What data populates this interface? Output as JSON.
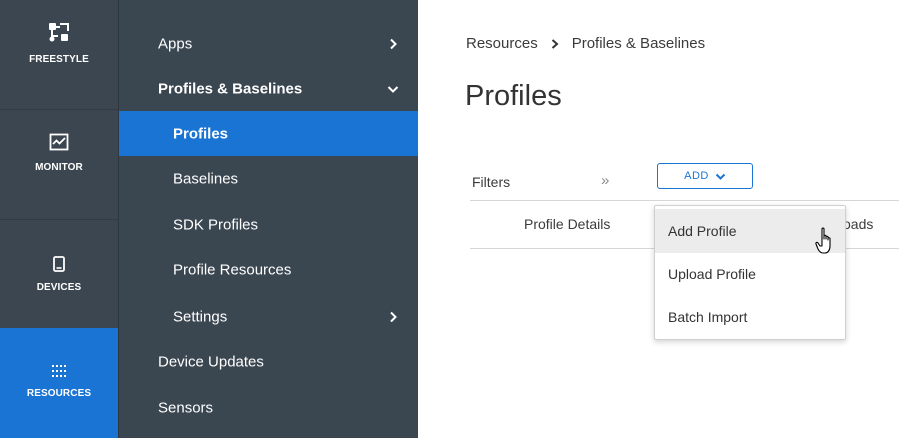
{
  "rail": {
    "items": [
      {
        "label": "FREESTYLE",
        "icon": "freestyle-icon"
      },
      {
        "label": "MONITOR",
        "icon": "monitor-icon"
      },
      {
        "label": "DEVICES",
        "icon": "device-icon"
      },
      {
        "label": "RESOURCES",
        "icon": "resources-icon"
      }
    ]
  },
  "subnav": {
    "items": [
      {
        "label": "Apps",
        "chevron": "right"
      },
      {
        "label": "Profiles & Baselines",
        "chevron": "down"
      },
      {
        "label": "Profiles"
      },
      {
        "label": "Baselines"
      },
      {
        "label": "SDK Profiles"
      },
      {
        "label": "Profile Resources"
      },
      {
        "label": "Settings",
        "chevron": "right"
      },
      {
        "label": "Device Updates"
      },
      {
        "label": "Sensors"
      }
    ]
  },
  "breadcrumb": {
    "root": "Resources",
    "current": "Profiles & Baselines"
  },
  "page": {
    "title": "Profiles"
  },
  "toolbar": {
    "filters_label": "Filters",
    "expand_glyph": "»",
    "add_label": "ADD"
  },
  "table": {
    "columns": [
      "Profile Details",
      "oads"
    ]
  },
  "dropdown": {
    "items": [
      "Add Profile",
      "Upload Profile",
      "Batch Import"
    ]
  },
  "colors": {
    "accent": "#1a74d4",
    "rail_bg": "#3b4650",
    "subnav_bg": "#3a4650"
  }
}
